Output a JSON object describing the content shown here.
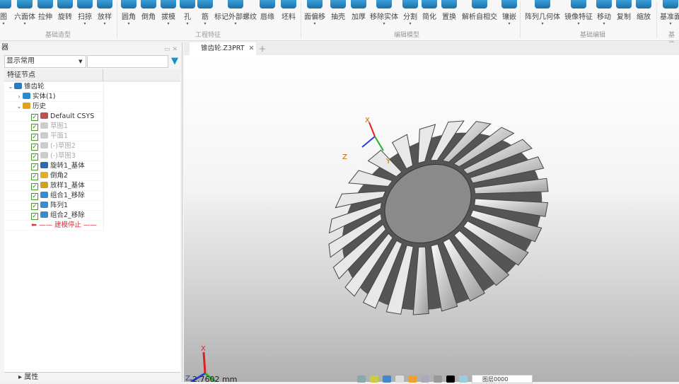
{
  "ribbon": {
    "buttons": [
      {
        "label": "图",
        "dd": true
      },
      {
        "label": "六面体",
        "dd": true
      },
      {
        "label": "拉伸",
        "dd": false
      },
      {
        "label": "旋转",
        "dd": false
      },
      {
        "label": "扫掠",
        "dd": true
      },
      {
        "label": "放样",
        "dd": true
      },
      {
        "label": "圆角",
        "dd": true
      },
      {
        "label": "倒角",
        "dd": false
      },
      {
        "label": "拔模",
        "dd": true
      },
      {
        "label": "孔",
        "dd": true
      },
      {
        "label": "筋",
        "dd": true
      },
      {
        "label": "标记外部螺纹",
        "dd": true
      },
      {
        "label": "唇缘",
        "dd": false
      },
      {
        "label": "坯料",
        "dd": false
      },
      {
        "label": "面偏移",
        "dd": true
      },
      {
        "label": "抽壳",
        "dd": false
      },
      {
        "label": "加厚",
        "dd": false
      },
      {
        "label": "移除实体",
        "dd": true
      },
      {
        "label": "分割",
        "dd": true
      },
      {
        "label": "简化",
        "dd": false
      },
      {
        "label": "置换",
        "dd": false
      },
      {
        "label": "解析自相交",
        "dd": false
      },
      {
        "label": "镶嵌",
        "dd": true
      },
      {
        "label": "阵列几何体",
        "dd": true
      },
      {
        "label": "镜像特征",
        "dd": true
      },
      {
        "label": "移动",
        "dd": true
      },
      {
        "label": "复制",
        "dd": false
      },
      {
        "label": "缩放",
        "dd": false
      },
      {
        "label": "基准面",
        "dd": true
      }
    ],
    "groups": [
      "基础造型",
      "工程特征",
      "编辑模型",
      "基础编辑",
      "基准面"
    ]
  },
  "panel": {
    "title": "器",
    "filter_value": "显示常用",
    "column_header": "特征节点",
    "tree": [
      {
        "label": "锥齿轮",
        "level": 0,
        "twisty": "⌄",
        "check": false,
        "state": "normal",
        "color": "#2a7ac0"
      },
      {
        "label": "实体(1)",
        "level": 1,
        "twisty": "›",
        "check": false,
        "state": "normal",
        "color": "#2a8ad0"
      },
      {
        "label": "历史",
        "level": 1,
        "twisty": "⌄",
        "check": false,
        "state": "normal",
        "color": "#e0a020"
      },
      {
        "label": "Default CSYS",
        "level": 2,
        "check": true,
        "state": "normal",
        "color": "#c05050"
      },
      {
        "label": "草图1",
        "level": 2,
        "check": true,
        "state": "grey",
        "color": "#ccc"
      },
      {
        "label": "平面1",
        "level": 2,
        "check": true,
        "state": "grey",
        "color": "#ccc"
      },
      {
        "label": "(-)草图2",
        "level": 2,
        "check": true,
        "state": "grey",
        "color": "#ccc"
      },
      {
        "label": "(-)草图3",
        "level": 2,
        "check": true,
        "state": "grey",
        "color": "#ccc"
      },
      {
        "label": "旋转1_基体",
        "level": 2,
        "check": true,
        "state": "normal",
        "color": "#2a6ab0"
      },
      {
        "label": "倒角2",
        "level": 2,
        "check": true,
        "state": "normal",
        "color": "#e0b020"
      },
      {
        "label": "放样1_基体",
        "level": 2,
        "check": true,
        "state": "normal",
        "color": "#d0a020"
      },
      {
        "label": "组合1_移除",
        "level": 2,
        "check": true,
        "state": "normal",
        "color": "#3a8ad0"
      },
      {
        "label": "阵列1",
        "level": 2,
        "check": true,
        "state": "normal",
        "color": "#3a8ad0"
      },
      {
        "label": "组合2_移除",
        "level": 2,
        "check": true,
        "state": "normal",
        "color": "#3a8ad0"
      },
      {
        "label": "—— 建模停止 ——",
        "level": 2,
        "check": false,
        "state": "stop",
        "color": "#e03040"
      }
    ],
    "bottom_section": "属性"
  },
  "tabs": {
    "active": "锥齿轮.Z3PRT",
    "close": "✕",
    "add": "+"
  },
  "viewport": {
    "axis_labels": [
      "X",
      "Y",
      "Z"
    ],
    "coord_readout": "-2.7602 mm",
    "layer": "图层0000"
  },
  "colors": {
    "accent": "#1a90c8",
    "axis_x": "#e02020",
    "axis_y": "#20b020",
    "axis_z": "#2040e0"
  }
}
